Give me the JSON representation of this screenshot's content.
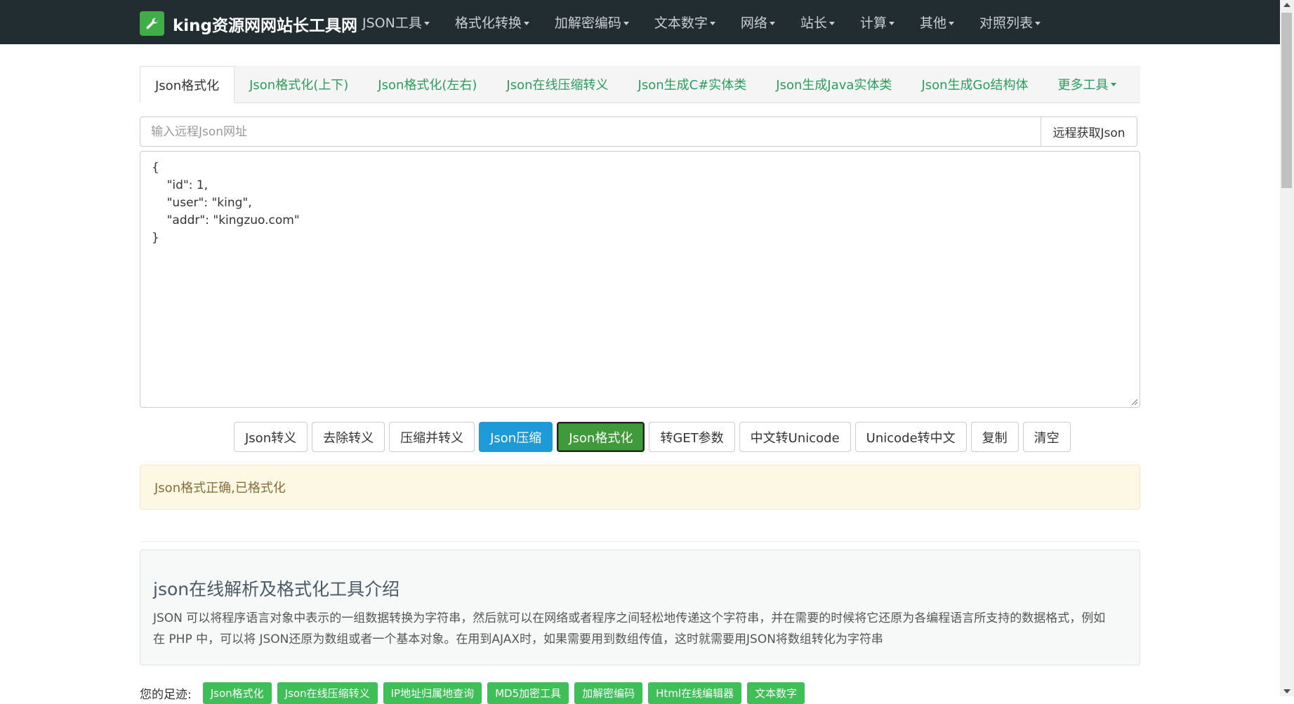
{
  "brand": {
    "name": "king资源网网站长工具网"
  },
  "nav": {
    "items": [
      "JSON工具",
      "格式化转换",
      "加解密编码",
      "文本数字",
      "网络",
      "站长",
      "计算",
      "其他",
      "对照列表"
    ]
  },
  "tabs": [
    "Json格式化",
    "Json格式化(上下)",
    "Json格式化(左右)",
    "Json在线压缩转义",
    "Json生成C#实体类",
    "Json生成Java实体类",
    "Json生成Go结构体",
    "更多工具"
  ],
  "remote": {
    "placeholder": "输入远程Json网址",
    "button": "远程获取Json"
  },
  "editor": {
    "content": "{\n    \"id\": 1,\n    \"user\": \"king\",\n    \"addr\": \"kingzuo.com\"\n}"
  },
  "actions": [
    "Json转义",
    "去除转义",
    "压缩并转义",
    "Json压缩",
    "Json格式化",
    "转GET参数",
    "中文转Unicode",
    "Unicode转中文",
    "复制",
    "清空"
  ],
  "alert": {
    "message": "Json格式正确,已格式化"
  },
  "intro": {
    "title": "json在线解析及格式化工具介绍",
    "text": "JSON 可以将程序语言对象中表示的一组数据转换为字符串，然后就可以在网络或者程序之间轻松地传递这个字符串，并在需要的时候将它还原为各编程语言所支持的数据格式，例如在 PHP 中，可以将 JSON还原为数组或者一个基本对象。在用到AJAX时，如果需要用到数组传值，这时就需要用JSON将数组转化为字符串"
  },
  "footprints": {
    "label": "您的足迹:",
    "tags": [
      "Json格式化",
      "Json在线压缩转义",
      "IP地址归属地查询",
      "MD5加密工具",
      "加解密编码",
      "Html在线编辑器",
      "文本数字"
    ]
  },
  "colors": {
    "navbar": "#222d32",
    "brand_green": "#3fae49",
    "tab_link": "#2a9d5c",
    "btn_blue": "#1e9bd7",
    "btn_green": "#3f9a3b",
    "alert_bg": "#fcf8e3",
    "tag_green": "#3fbf57"
  }
}
